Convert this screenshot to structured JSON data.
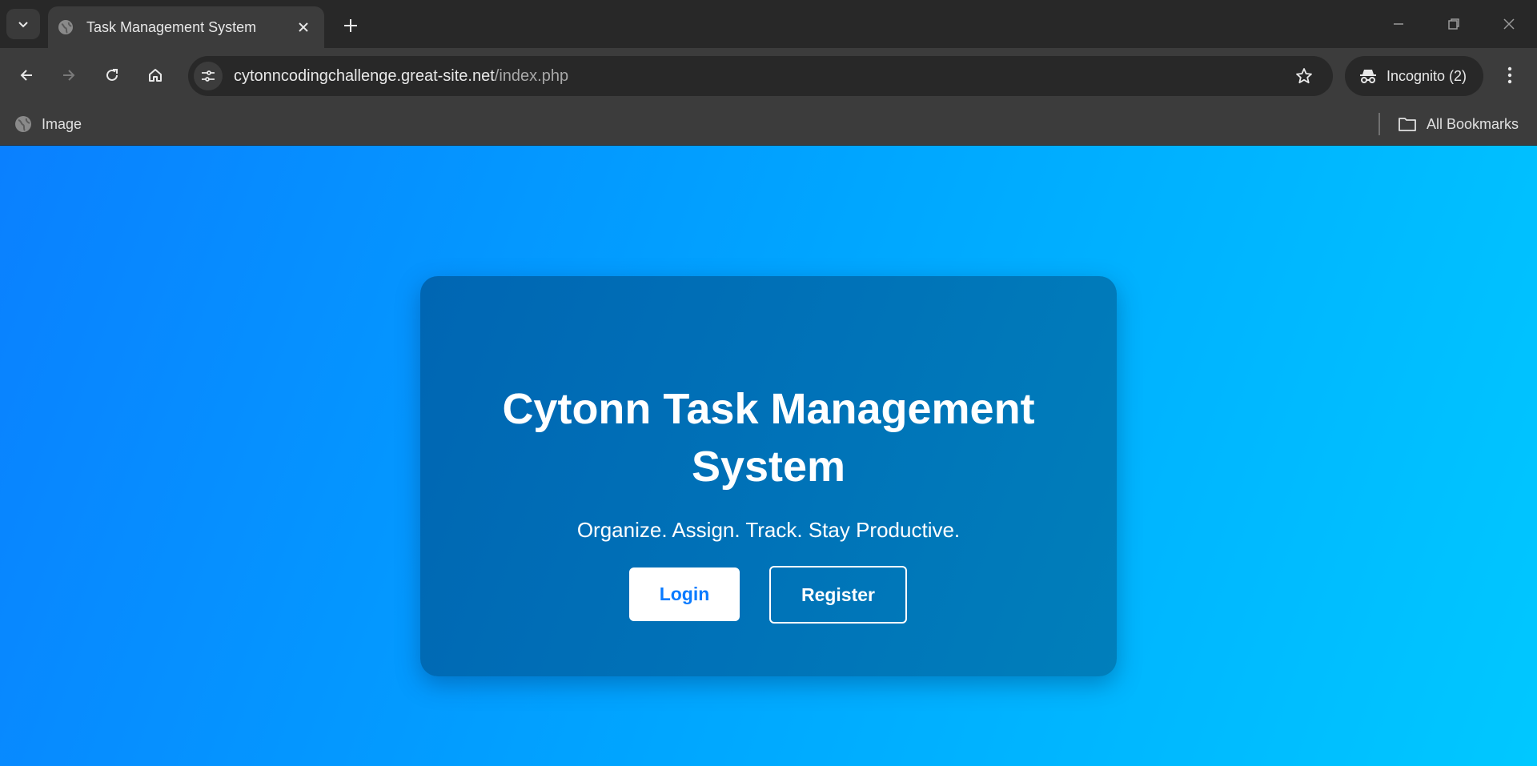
{
  "browser": {
    "tab": {
      "title": "Task Management System"
    },
    "address": {
      "domain": "cytonncodingchallenge.great-site.net",
      "path": "/index.php"
    },
    "profile": {
      "label": "Incognito (2)"
    },
    "bookmarks": {
      "items": [
        {
          "label": "Image"
        }
      ],
      "all_label": "All Bookmarks"
    },
    "icons": {
      "tab_search": "chevron-down-icon",
      "favicon": "globe-icon",
      "tab_close": "close-icon",
      "new_tab": "plus-icon",
      "back": "arrow-left-icon",
      "forward": "arrow-right-icon",
      "reload": "reload-icon",
      "home": "home-icon",
      "site_info": "tune-icon",
      "bookmark_star": "star-icon",
      "incognito": "incognito-icon",
      "menu": "more-vertical-icon",
      "folder": "folder-icon"
    }
  },
  "hero": {
    "title": "Cytonn Task Management System",
    "subtitle": "Organize. Assign. Track. Stay Productive.",
    "login_label": "Login",
    "register_label": "Register"
  },
  "colors": {
    "page_gradient_start": "#0a80ff",
    "page_gradient_end": "#00c8ff",
    "card_background": "#006bb5",
    "login_text": "#0a7bff",
    "browser_frame": "#282828",
    "browser_toolbar": "#3c3c3c"
  }
}
